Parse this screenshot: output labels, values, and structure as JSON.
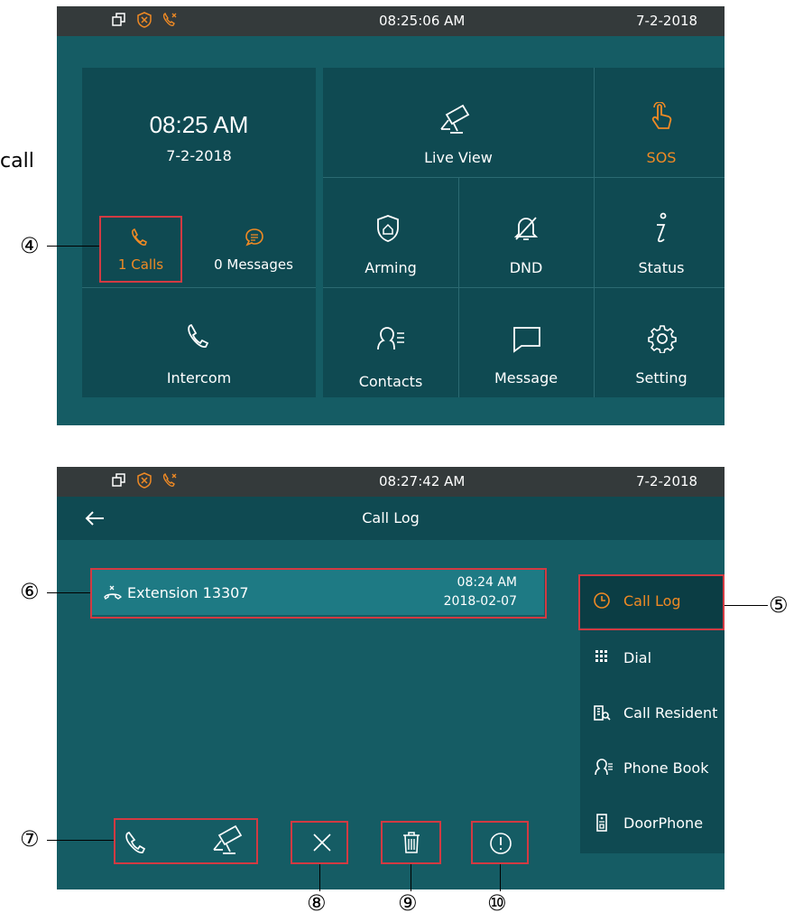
{
  "annotations": {
    "partial_text": "call",
    "num4": "④",
    "num5": "⑤",
    "num6": "⑥",
    "num7": "⑦",
    "num8": "⑧",
    "num9": "⑨",
    "num10": "⑩"
  },
  "screen1": {
    "status": {
      "time": "08:25:06   AM",
      "date": "7-2-2018"
    },
    "clock": {
      "time": "08:25 AM",
      "date": "7-2-2018"
    },
    "calls": {
      "label": "1 Calls"
    },
    "messages": {
      "label": "0 Messages"
    },
    "tiles": {
      "intercom": "Intercom",
      "live_view": "Live View",
      "sos": "SOS",
      "arming": "Arming",
      "dnd": "DND",
      "status": "Status",
      "contacts": "Contacts",
      "message": "Message",
      "setting": "Setting"
    }
  },
  "screen2": {
    "status": {
      "time": "08:27:42   AM",
      "date": "7-2-2018"
    },
    "title": "Call Log",
    "entry": {
      "name": "Extension 13307",
      "time": "08:24 AM",
      "date": "2018-02-07"
    },
    "side": {
      "call_log": "Call Log",
      "dial": "Dial",
      "call_resident": "Call Resident",
      "phone_book": "Phone Book",
      "doorphone": "DoorPhone"
    }
  },
  "colors": {
    "accent": "#f08a24",
    "screen_bg": "#155c64",
    "tile_bg": "#0f4a52",
    "status_bg": "#343a3b",
    "highlight": "#d23a42"
  }
}
